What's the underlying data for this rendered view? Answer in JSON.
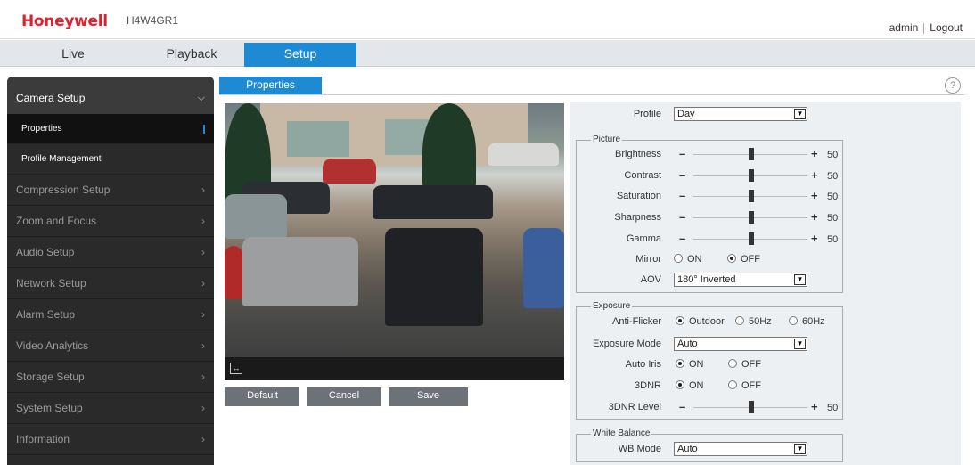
{
  "header": {
    "brand": "Honeywell",
    "model": "H4W4GR1",
    "user": "admin",
    "logout": "Logout"
  },
  "tabs": [
    {
      "label": "Live",
      "active": false
    },
    {
      "label": "Playback",
      "active": false
    },
    {
      "label": "Setup",
      "active": true
    }
  ],
  "sidebar": {
    "section": "Camera Setup",
    "sub_items": [
      {
        "label": "Properties",
        "active": true
      },
      {
        "label": "Profile Management",
        "active": false
      }
    ],
    "items": [
      {
        "label": "Compression Setup"
      },
      {
        "label": "Zoom and Focus"
      },
      {
        "label": "Audio Setup"
      },
      {
        "label": "Network Setup"
      },
      {
        "label": "Alarm Setup"
      },
      {
        "label": "Video Analytics"
      },
      {
        "label": "Storage Setup"
      },
      {
        "label": "System Setup"
      },
      {
        "label": "Information"
      }
    ]
  },
  "content": {
    "tab": "Properties",
    "help_icon": "?",
    "buttons": {
      "default": "Default",
      "cancel": "Cancel",
      "save": "Save"
    }
  },
  "settings": {
    "profile": {
      "label": "Profile",
      "value": "Day"
    },
    "picture": {
      "legend": "Picture",
      "brightness": {
        "label": "Brightness",
        "value": "50"
      },
      "contrast": {
        "label": "Contrast",
        "value": "50"
      },
      "saturation": {
        "label": "Saturation",
        "value": "50"
      },
      "sharpness": {
        "label": "Sharpness",
        "value": "50"
      },
      "gamma": {
        "label": "Gamma",
        "value": "50"
      },
      "mirror": {
        "label": "Mirror",
        "on": "ON",
        "off": "OFF",
        "selected": "OFF"
      },
      "aov": {
        "label": "AOV",
        "value": "180° Inverted"
      }
    },
    "exposure": {
      "legend": "Exposure",
      "anti_flicker": {
        "label": "Anti-Flicker",
        "outdoor": "Outdoor",
        "hz50": "50Hz",
        "hz60": "60Hz",
        "selected": "Outdoor"
      },
      "mode": {
        "label": "Exposure Mode",
        "value": "Auto"
      },
      "auto_iris": {
        "label": "Auto Iris",
        "on": "ON",
        "off": "OFF",
        "selected": "ON"
      },
      "dnr3": {
        "label": "3DNR",
        "on": "ON",
        "off": "OFF",
        "selected": "ON"
      },
      "dnr3_level": {
        "label": "3DNR Level",
        "value": "50"
      }
    },
    "white_balance": {
      "legend": "White Balance",
      "wb_mode": {
        "label": "WB Mode",
        "value": "Auto"
      }
    }
  },
  "colors": {
    "accent": "#1e8ad3",
    "brand": "#e0202c",
    "sidebar": "#2a2a2a"
  }
}
